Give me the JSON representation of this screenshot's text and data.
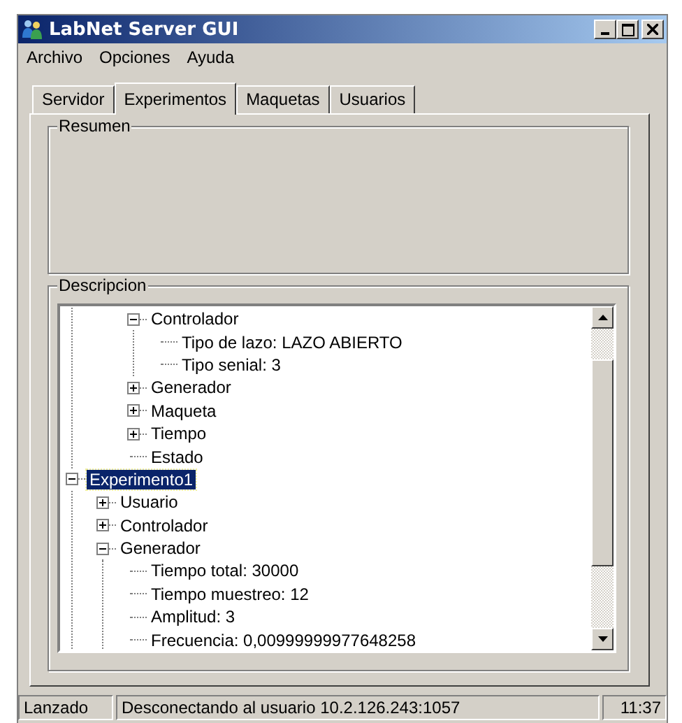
{
  "window": {
    "title": "LabNet Server GUI"
  },
  "menu": [
    {
      "label": "Archivo"
    },
    {
      "label": "Opciones"
    },
    {
      "label": "Ayuda"
    }
  ],
  "tabs": [
    {
      "label": "Servidor",
      "selected": false
    },
    {
      "label": "Experimentos",
      "selected": true
    },
    {
      "label": "Maquetas",
      "selected": false
    },
    {
      "label": "Usuarios",
      "selected": false
    }
  ],
  "summary": {
    "title": "Resumen"
  },
  "description": {
    "title": "Descripcion",
    "tree": {
      "items": [
        {
          "children": [
            {
              "label": "Controlador",
              "expanded": true,
              "selected": false,
              "children": [
                {
                  "label": "Tipo de lazo: LAZO ABIERTO",
                  "selected": false
                },
                {
                  "label": "Tipo senial: 3",
                  "selected": false
                }
              ]
            },
            {
              "label": "Generador",
              "expanded": false,
              "selected": false
            },
            {
              "label": "Maqueta",
              "expanded": false,
              "selected": false
            },
            {
              "label": "Tiempo",
              "expanded": false,
              "selected": false
            },
            {
              "label": "Estado",
              "selected": false
            }
          ]
        },
        {
          "label": "Experimento1",
          "expanded": true,
          "selected": true,
          "children": [
            {
              "label": "Usuario",
              "expanded": false,
              "selected": false
            },
            {
              "label": "Controlador",
              "expanded": false,
              "selected": false
            },
            {
              "label": "Generador",
              "expanded": true,
              "selected": false,
              "children": [
                {
                  "label": "Tiempo total: 30000",
                  "selected": false
                },
                {
                  "label": "Tiempo muestreo: 12",
                  "selected": false
                },
                {
                  "label": "Amplitud: 3",
                  "selected": false
                },
                {
                  "label": "Frecuencia: 0,00999999977648258",
                  "selected": false
                }
              ]
            }
          ]
        }
      ]
    }
  },
  "status_bar": [
    "Lanzado",
    "Desconectando al usuario 10.2.126.243:1057",
    "11:37"
  ]
}
